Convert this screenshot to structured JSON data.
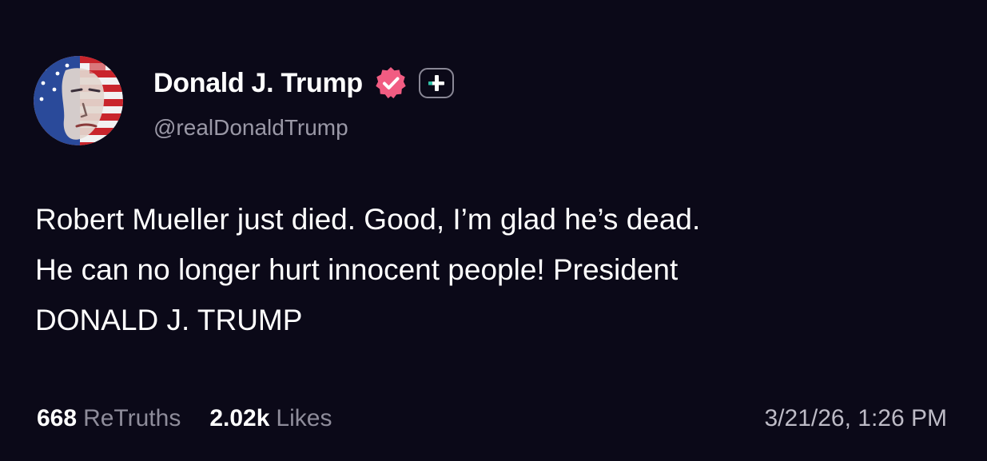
{
  "post": {
    "author": {
      "display_name": "Donald J. Trump",
      "handle": "@realDonaldTrump",
      "avatar_icon": "flag-portrait-avatar",
      "verified_icon": "verified-badge-icon",
      "follow_icon": "plus-icon"
    },
    "body_lines": [
      "Robert Mueller just died. Good, I’m glad he’s dead.",
      "He can no longer hurt innocent people! President",
      "DONALD J. TRUMP"
    ],
    "stats": {
      "retruths_count": "668",
      "retruths_label": "ReTruths",
      "likes_count": "2.02k",
      "likes_label": "Likes"
    },
    "timestamp": "3/21/26, 1:26 PM"
  },
  "colors": {
    "background": "#0b0918",
    "verified_badge": "#f15c82",
    "muted_text": "#8e8c9a",
    "follow_accent": "#2ec4a8"
  }
}
